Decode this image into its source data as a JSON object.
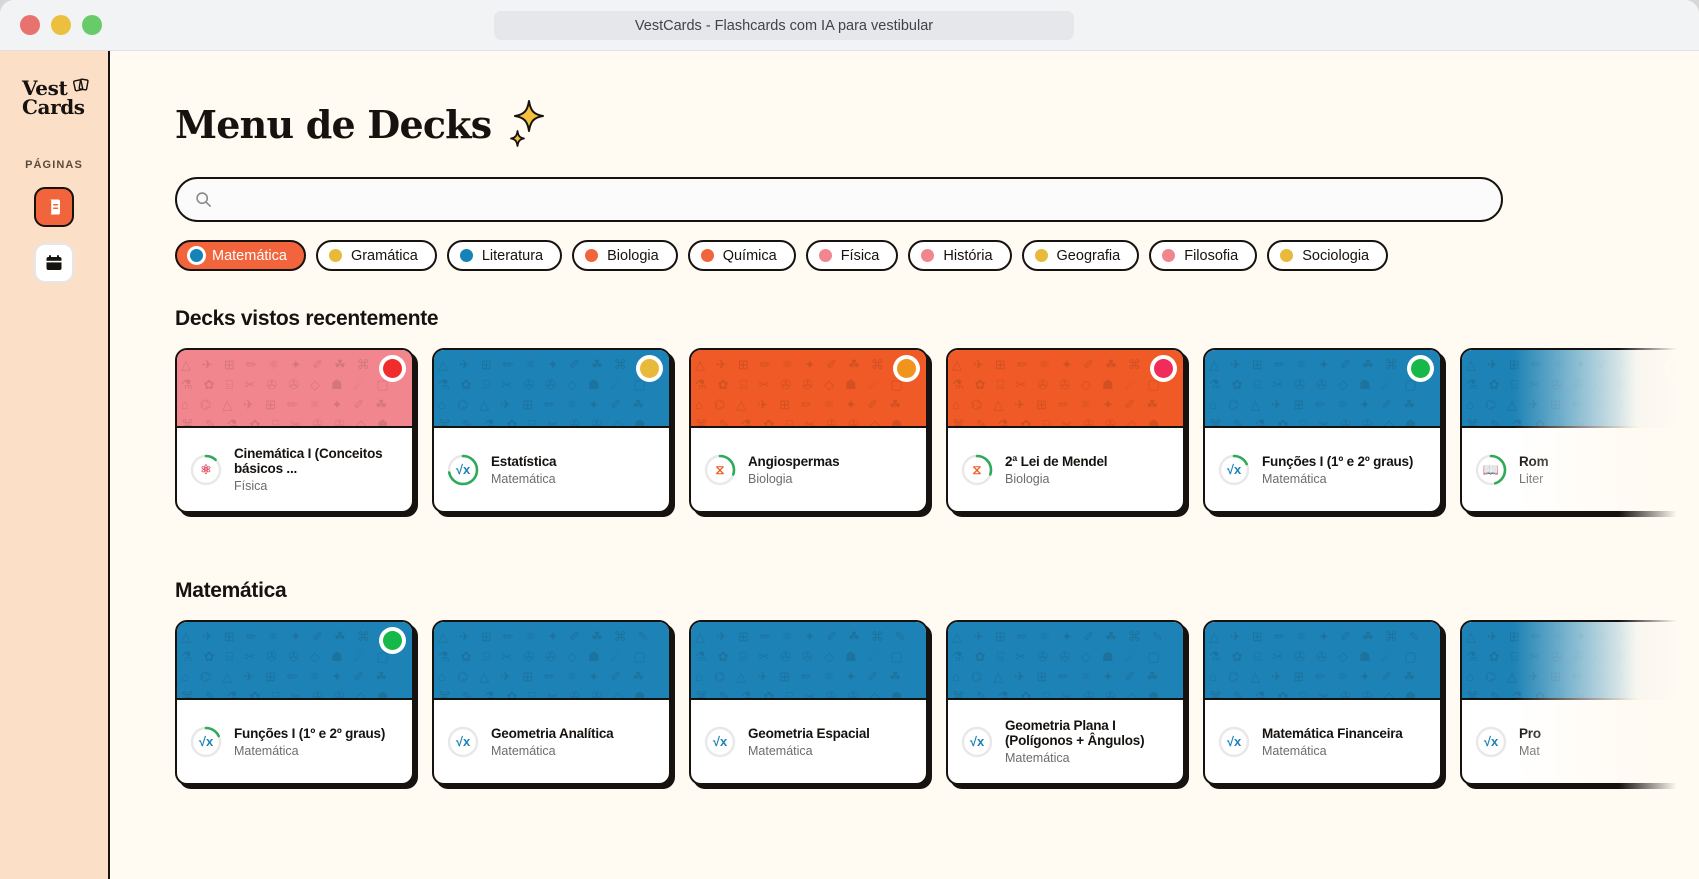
{
  "window": {
    "title": "VestCards - Flashcards com IA para vestibular",
    "traffic_lights": [
      "close",
      "minimize",
      "maximize"
    ]
  },
  "sidebar": {
    "logo_line1": "Vest",
    "logo_line2": "Cards",
    "section_label": "PÁGINAS",
    "items": [
      {
        "name": "decks",
        "icon": "notebook-icon",
        "active": true
      },
      {
        "name": "calendario",
        "icon": "calendar-icon",
        "active": false
      }
    ]
  },
  "main": {
    "page_title": "Menu de Decks",
    "sparkle_icon": "sparkle-icon",
    "search": {
      "value": "",
      "placeholder": "",
      "icon": "search-icon"
    },
    "filters": [
      {
        "label": "Matemática",
        "color": "#1683b8",
        "selected": true
      },
      {
        "label": "Gramática",
        "color": "#e9b93c",
        "selected": false
      },
      {
        "label": "Literatura",
        "color": "#1683b8",
        "selected": false
      },
      {
        "label": "Biologia",
        "color": "#f2643c",
        "selected": false
      },
      {
        "label": "Química",
        "color": "#f2643c",
        "selected": false
      },
      {
        "label": "Física",
        "color": "#f2868f",
        "selected": false
      },
      {
        "label": "História",
        "color": "#f2868f",
        "selected": false
      },
      {
        "label": "Geografia",
        "color": "#e9b93c",
        "selected": false
      },
      {
        "label": "Filosofia",
        "color": "#f2868f",
        "selected": false
      },
      {
        "label": "Sociologia",
        "color": "#e9b93c",
        "selected": false
      }
    ],
    "sections": [
      {
        "title": "Decks vistos recentemente",
        "cards": [
          {
            "name": "Cinemática I (Conceitos básicos ...",
            "subject": "Física",
            "banner_color": "#f2868f",
            "status_color": "#f02d2d",
            "icon": "atom-icon",
            "progress": 12,
            "progress_color": "#2faa5a"
          },
          {
            "name": "Estatística",
            "subject": "Matemática",
            "banner_color": "#1d82b5",
            "status_color": "#e9b93c",
            "icon": "sqrt-icon",
            "progress": 72,
            "progress_color": "#2faa5a"
          },
          {
            "name": "Angiospermas",
            "subject": "Biologia",
            "banner_color": "#ef5a26",
            "status_color": "#f0941e",
            "icon": "dna-icon",
            "progress": 30,
            "progress_color": "#2faa5a"
          },
          {
            "name": "2ª Lei de Mendel",
            "subject": "Biologia",
            "banner_color": "#ef5a26",
            "status_color": "#f02d5a",
            "icon": "dna-icon",
            "progress": 30,
            "progress_color": "#2faa5a"
          },
          {
            "name": "Funções I (1º e 2º graus)",
            "subject": "Matemática",
            "banner_color": "#1d82b5",
            "status_color": "#17b84a",
            "icon": "sqrt-icon",
            "progress": 18,
            "progress_color": "#2faa5a"
          },
          {
            "name": "Rom",
            "subject": "Liter",
            "banner_color": "#1d82b5",
            "status_color": "#1d82b5",
            "icon": "book-icon",
            "progress": 45,
            "progress_color": "#2faa5a"
          }
        ]
      },
      {
        "title": "Matemática",
        "cards": [
          {
            "name": "Funções I (1º e 2º graus)",
            "subject": "Matemática",
            "banner_color": "#1d82b5",
            "status_color": "#17b84a",
            "icon": "sqrt-icon",
            "progress": 18,
            "progress_color": "#2faa5a"
          },
          {
            "name": "Geometria Analítica",
            "subject": "Matemática",
            "banner_color": "#1d82b5",
            "status_color": "",
            "icon": "sqrt-icon",
            "progress": 0,
            "progress_color": "#cfcfcf"
          },
          {
            "name": "Geometria Espacial",
            "subject": "Matemática",
            "banner_color": "#1d82b5",
            "status_color": "",
            "icon": "sqrt-icon",
            "progress": 0,
            "progress_color": "#cfcfcf"
          },
          {
            "name": "Geometria Plana I (Polígonos + Ângulos)",
            "subject": "Matemática",
            "banner_color": "#1d82b5",
            "status_color": "",
            "icon": "sqrt-icon",
            "progress": 0,
            "progress_color": "#cfcfcf"
          },
          {
            "name": "Matemática Financeira",
            "subject": "Matemática",
            "banner_color": "#1d82b5",
            "status_color": "",
            "icon": "sqrt-icon",
            "progress": 0,
            "progress_color": "#cfcfcf"
          },
          {
            "name": "Pro",
            "subject": "Mat",
            "banner_color": "#1d82b5",
            "status_color": "",
            "icon": "sqrt-icon",
            "progress": 0,
            "progress_color": "#cfcfcf"
          }
        ]
      }
    ]
  },
  "theme": {
    "accent": "#f2643c",
    "sidebar_bg": "#fbdfc6",
    "page_bg": "#fffaf2",
    "ink": "#16120f"
  }
}
